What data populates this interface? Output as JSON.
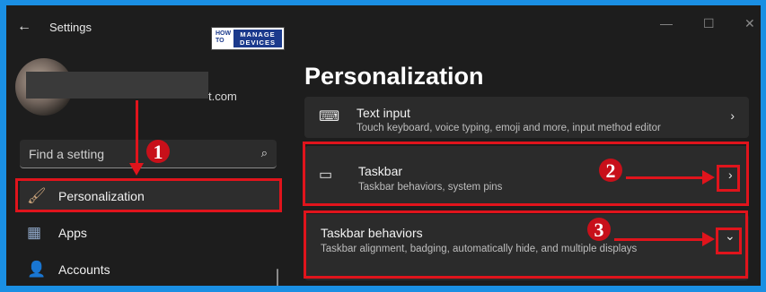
{
  "window": {
    "title": "Settings",
    "back": "←",
    "min": "—",
    "max": "☐",
    "close": "✕"
  },
  "logo": {
    "how_to": "HOW TO",
    "manage": "MANAGE",
    "devices": "DEVICES"
  },
  "account": {
    "email_suffix": "t.com"
  },
  "search": {
    "placeholder": "Find a setting",
    "icon": "⌕"
  },
  "nav": {
    "items": [
      {
        "label": "Personalization",
        "icon": "brush-icon",
        "glyph": "🖌",
        "selected": true
      },
      {
        "label": "Apps",
        "icon": "apps-icon",
        "glyph": "▦"
      },
      {
        "label": "Accounts",
        "icon": "accounts-icon",
        "glyph": "👤"
      }
    ]
  },
  "main": {
    "title": "Personalization",
    "cards": [
      {
        "title": "Text input",
        "subtitle": "Touch keyboard, voice typing, emoji and more, input method editor",
        "icon": "keyboard-icon",
        "glyph": "⌨",
        "chevron": "›"
      },
      {
        "title": "Taskbar",
        "subtitle": "Taskbar behaviors, system pins",
        "icon": "taskbar-icon",
        "glyph": "▭",
        "chevron": "›"
      },
      {
        "title": "Taskbar behaviors",
        "subtitle": "Taskbar alignment, badging, automatically hide, and multiple displays",
        "chevron": "⌄"
      }
    ]
  },
  "annotations": {
    "badges": [
      "1",
      "2",
      "3"
    ],
    "color": "#e0141c"
  },
  "colors": {
    "desktop": "#1a8fe3",
    "window": "#1d1d1d",
    "card": "#2b2b2b"
  }
}
